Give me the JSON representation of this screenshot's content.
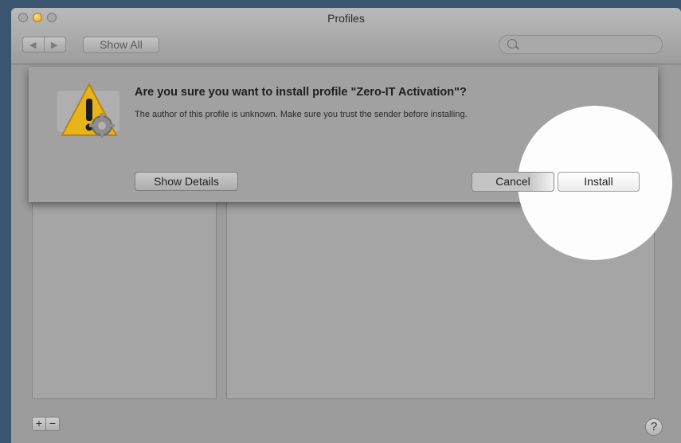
{
  "window": {
    "title": "Profiles"
  },
  "toolbar": {
    "back_label": "◀",
    "forward_label": "▶",
    "show_all_label": "Show All",
    "search_placeholder": "",
    "search_value": ""
  },
  "dialog": {
    "heading": "Are you sure you want to install profile \"Zero-IT Activation\"?",
    "message": "The author of this profile is unknown. Make sure you trust the sender before installing.",
    "show_details_label": "Show Details",
    "cancel_label": "Cancel",
    "install_label": "Install",
    "icon": "warning-icon"
  },
  "footer": {
    "add_label": "+",
    "remove_label": "−",
    "help_label": "?"
  },
  "colors": {
    "warning_yellow": "#e8b41a",
    "desktop": "#3b5570",
    "window_dim": "#9c9c9c"
  }
}
